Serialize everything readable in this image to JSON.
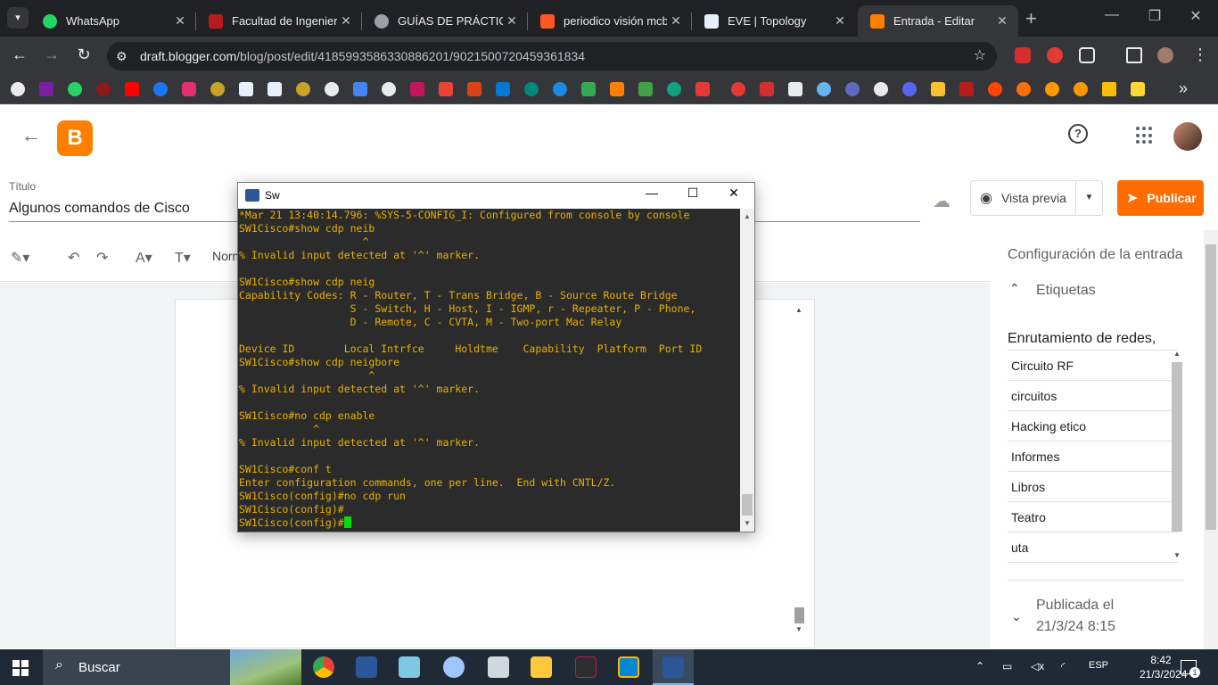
{
  "browser": {
    "tabs": [
      {
        "title": "WhatsApp",
        "icon": "whatsapp-icon",
        "color": "#25d366"
      },
      {
        "title": "Facultad de Ingeniería",
        "icon": "university-icon",
        "color": "#b71c1c"
      },
      {
        "title": "GUÍAS DE PRÁCTICAS",
        "icon": "globe-icon",
        "color": "#9aa0a6"
      },
      {
        "title": "periodico visión mcb",
        "icon": "blogger-icon",
        "color": "#ff5722"
      },
      {
        "title": "EVE | Topology",
        "icon": "eve-icon",
        "color": "#e8f0fe"
      },
      {
        "title": "Entrada - Editar",
        "icon": "blogger-icon",
        "color": "#ff8000"
      }
    ],
    "close_glyph": "✕",
    "new_tab_glyph": "+",
    "url_domain": "draft.blogger.com",
    "url_path": "/blog/post/edit/4185993586330886201/9021500720459361834"
  },
  "blogger": {
    "title_label": "Título",
    "post_title": "Algunos comandos de Cisco",
    "format_text": "Norm",
    "preview_label": "Vista previa",
    "publish_label": "Publicar",
    "sidebar": {
      "heading": "Configuración de la entrada",
      "labels_heading": "Etiquetas",
      "labels_input": "Enrutamiento de redes,",
      "label_options": [
        "Circuito RF",
        "circuitos",
        "Hacking etico",
        "Informes",
        "Libros",
        "Teatro",
        "uta"
      ],
      "published_heading": "Publicada el",
      "published_date": "21/3/24 8:15"
    }
  },
  "terminal": {
    "title": "Sw",
    "lines": [
      "*Mar 21 13:40:14.796: %SYS-5-CONFIG_I: Configured from console by console",
      "SW1Cisco#show cdp neib",
      "                    ^",
      "% Invalid input detected at '^' marker.",
      "",
      "SW1Cisco#show cdp neig",
      "Capability Codes: R - Router, T - Trans Bridge, B - Source Route Bridge",
      "                  S - Switch, H - Host, I - IGMP, r - Repeater, P - Phone,",
      "                  D - Remote, C - CVTA, M - Two-port Mac Relay",
      "",
      "Device ID        Local Intrfce     Holdtme    Capability  Platform  Port ID",
      "SW1Cisco#show cdp neigbore",
      "                     ^",
      "% Invalid input detected at '^' marker.",
      "",
      "SW1Cisco#no cdp enable",
      "            ^",
      "% Invalid input detected at '^' marker.",
      "",
      "SW1Cisco#conf t",
      "Enter configuration commands, one per line.  End with CNTL/Z.",
      "SW1Cisco(config)#no cdp run",
      "SW1Cisco(config)#"
    ],
    "prompt_line": "SW1Cisco(config)#"
  },
  "taskbar": {
    "search_placeholder": "Buscar",
    "language": "ESP",
    "time": "8:42",
    "date": "21/3/2024",
    "notification_count": "1"
  }
}
